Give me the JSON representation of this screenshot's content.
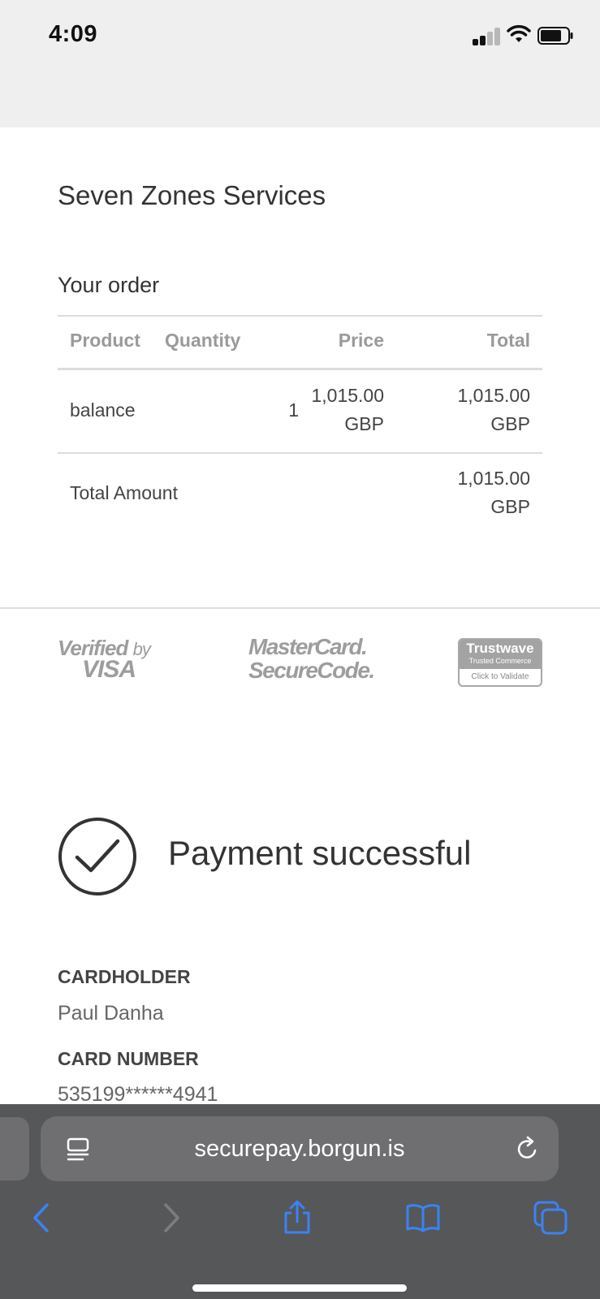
{
  "status_bar": {
    "time": "4:09"
  },
  "merchant": {
    "name": "Seven Zones Services"
  },
  "order": {
    "heading": "Your order",
    "columns": {
      "product": "Product",
      "quantity": "Quantity",
      "price": "Price",
      "total": "Total"
    },
    "rows": [
      {
        "product": "balance",
        "quantity": "1",
        "price_amount": "1,015.00",
        "price_currency": "GBP",
        "total_amount": "1,015.00",
        "total_currency": "GBP"
      }
    ],
    "total_label": "Total Amount",
    "total_amount": "1,015.00",
    "total_currency": "GBP"
  },
  "badges": {
    "visa_line1": "Verified",
    "visa_by": "by",
    "visa_line2": "VISA",
    "mc_line1": "MasterCard.",
    "mc_line2": "SecureCode.",
    "trustwave_name": "Trustwave",
    "trustwave_sub": "Trusted Commerce",
    "trustwave_action": "Click to Validate"
  },
  "payment": {
    "status": "Payment successful",
    "cardholder_label": "CARDHOLDER",
    "cardholder_value": "Paul Danha",
    "card_number_label": "CARD NUMBER",
    "card_number_value": "535199******4941"
  },
  "browser": {
    "url": "securepay.borgun.is",
    "accent_color": "#3b82f6"
  }
}
